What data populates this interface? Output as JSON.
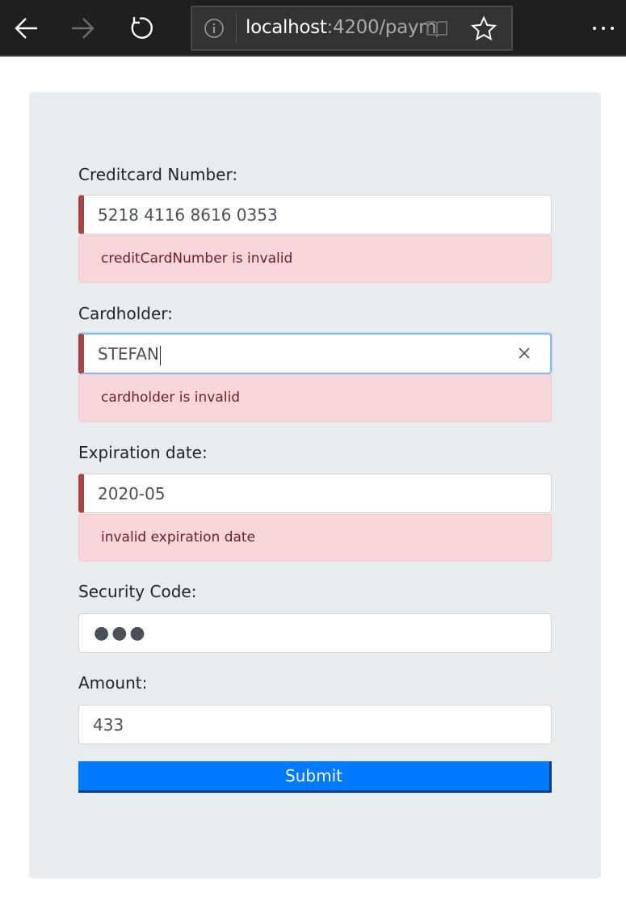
{
  "browser": {
    "url_host": "localhost",
    "url_rest": ":4200/paym",
    "icons": [
      "back-arrow-icon",
      "forward-arrow-icon",
      "reload-icon",
      "info-icon",
      "reading-view-icon",
      "favorite-star-icon",
      "more-icon"
    ]
  },
  "form": {
    "credit_card": {
      "label": "Creditcard Number:",
      "value": "5218 4116 8616 0353",
      "error": "creditCardNumber is invalid"
    },
    "cardholder": {
      "label": "Cardholder:",
      "value": "STEFAN",
      "error": "cardholder is invalid"
    },
    "expiration": {
      "label": "Expiration date:",
      "value": "2020-05",
      "error": "invalid expiration date"
    },
    "security_code": {
      "label": "Security Code:",
      "masked_value": "●●●"
    },
    "amount": {
      "label": "Amount:",
      "value": "433"
    },
    "submit_label": "Submit"
  },
  "colors": {
    "accent": "#007bff",
    "invalid_border": "#a94442",
    "alert_bg": "#f8d7da",
    "alert_text": "#721c24",
    "card_bg": "#e9ecef"
  }
}
